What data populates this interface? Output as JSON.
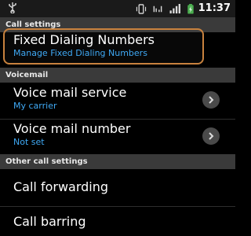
{
  "status_bar": {
    "time": "11:37",
    "icons": [
      "usb-icon",
      "vibrate-icon",
      "data-signal-icon",
      "signal-bars-icon",
      "battery-charging-icon"
    ]
  },
  "sections": {
    "call_settings": "Call settings",
    "voicemail": "Voicemail",
    "other_call_settings": "Other call settings"
  },
  "items": {
    "fixed_dialing": {
      "title": "Fixed Dialing Numbers",
      "subtitle": "Manage Fixed Dialing Numbers"
    },
    "voicemail_service": {
      "title": "Voice mail service",
      "subtitle": "My carrier"
    },
    "voicemail_number": {
      "title": "Voice mail number",
      "subtitle": "Not set"
    },
    "call_forwarding": {
      "title": "Call forwarding"
    },
    "call_barring": {
      "title": "Call barring"
    }
  },
  "colors": {
    "accent_blue": "#3fa9f5",
    "highlight_border": "#c8823e",
    "section_bg": "#3a3a3a",
    "background": "#000000"
  }
}
